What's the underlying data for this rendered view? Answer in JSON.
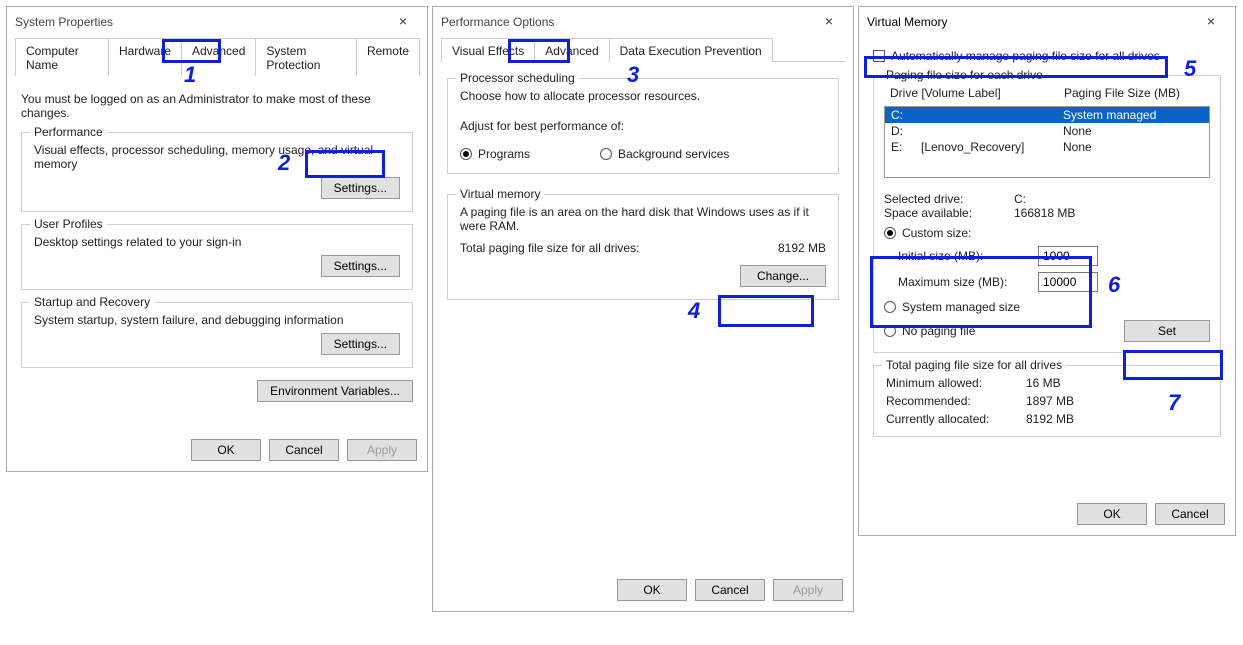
{
  "win1": {
    "title": "System Properties",
    "tabs": [
      "Computer Name",
      "Hardware",
      "Advanced",
      "System Protection",
      "Remote"
    ],
    "intro": "You must be logged on as an Administrator to make most of these changes.",
    "perf": {
      "title": "Performance",
      "desc": "Visual effects, processor scheduling, memory usage, and virtual memory",
      "btn": "Settings..."
    },
    "profiles": {
      "title": "User Profiles",
      "desc": "Desktop settings related to your sign-in",
      "btn": "Settings..."
    },
    "startup": {
      "title": "Startup and Recovery",
      "desc": "System startup, system failure, and debugging information",
      "btn": "Settings..."
    },
    "env_btn": "Environment Variables...",
    "ok": "OK",
    "cancel": "Cancel",
    "apply": "Apply"
  },
  "win2": {
    "title": "Performance Options",
    "tabs": [
      "Visual Effects",
      "Advanced",
      "Data Execution Prevention"
    ],
    "sched": {
      "title": "Processor scheduling",
      "l1": "Choose how to allocate processor resources.",
      "l2": "Adjust for best performance of:",
      "opt1": "Programs",
      "opt2": "Background services"
    },
    "vmem": {
      "title": "Virtual memory",
      "l1": "A paging file is an area on the hard disk that Windows uses as if it were RAM.",
      "l2": "Total paging file size for all drives:",
      "val": "8192 MB",
      "btn": "Change..."
    },
    "ok": "OK",
    "cancel": "Cancel",
    "apply": "Apply"
  },
  "win3": {
    "title": "Virtual Memory",
    "auto": "Automatically manage paging file size for all drives",
    "group_title": "Paging file size for each drive",
    "hdr_drive": "Drive  [Volume Label]",
    "hdr_size": "Paging File Size (MB)",
    "drives": [
      {
        "d": "C:",
        "label": "",
        "size": "System managed"
      },
      {
        "d": "D:",
        "label": "",
        "size": "None"
      },
      {
        "d": "E:",
        "label": "[Lenovo_Recovery]",
        "size": "None"
      }
    ],
    "sel_drive_l": "Selected drive:",
    "sel_drive_v": "C:",
    "space_l": "Space available:",
    "space_v": "166818 MB",
    "custom": "Custom size:",
    "init_l": "Initial size (MB):",
    "init_v": "1000",
    "max_l": "Maximum size (MB):",
    "max_v": "10000",
    "sys_managed": "System managed size",
    "no_paging": "No paging file",
    "set_btn": "Set",
    "totals_title": "Total paging file size for all drives",
    "min_l": "Minimum allowed:",
    "min_v": "16 MB",
    "rec_l": "Recommended:",
    "rec_v": "1897 MB",
    "cur_l": "Currently allocated:",
    "cur_v": "8192 MB",
    "ok": "OK",
    "cancel": "Cancel"
  },
  "ann": {
    "n1": "1",
    "n2": "2",
    "n3": "3",
    "n4": "4",
    "n5": "5",
    "n6": "6",
    "n7": "7"
  }
}
